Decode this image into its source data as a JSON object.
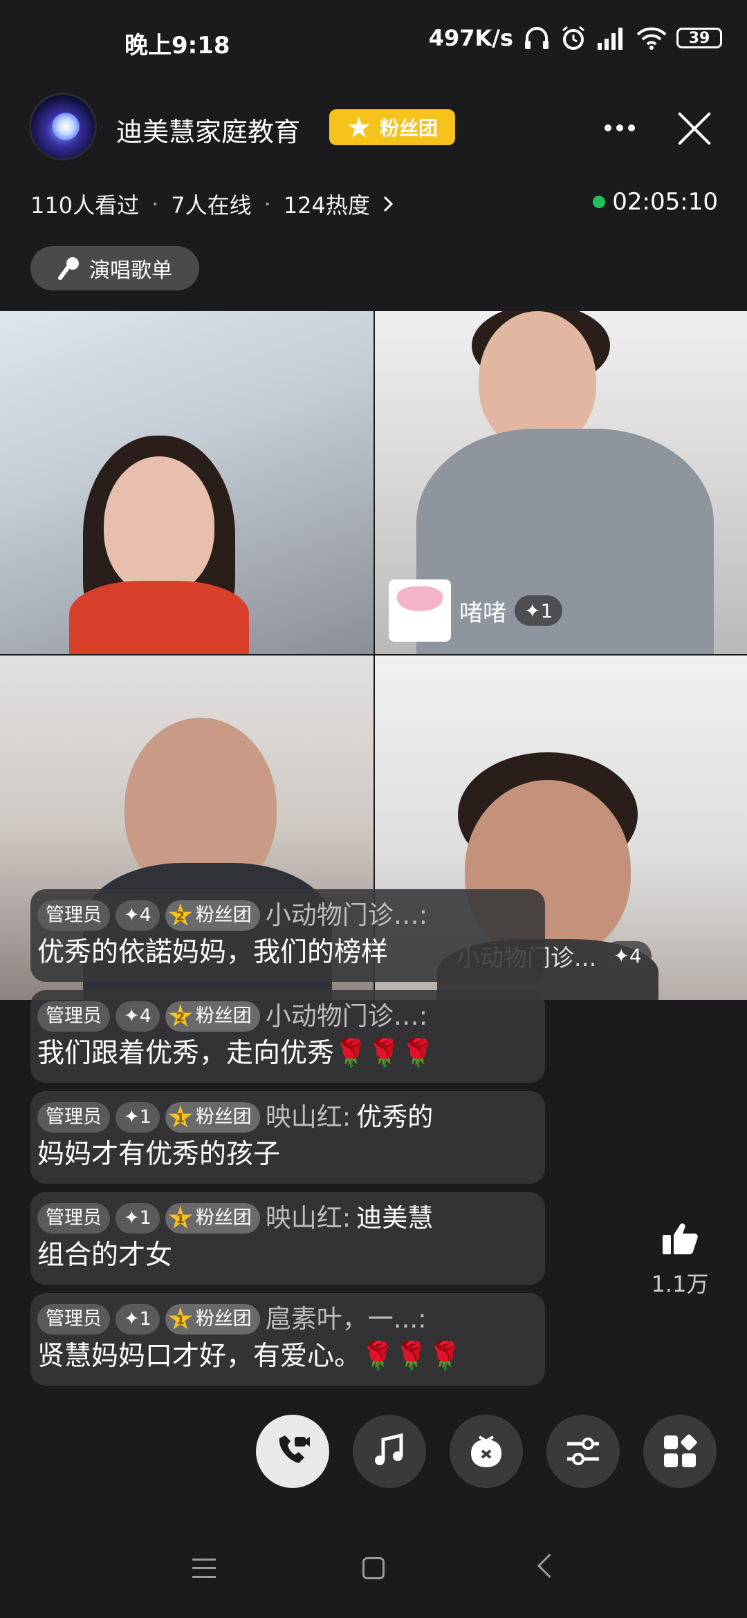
{
  "status": {
    "time": "晚上9:18",
    "speed": "497K/s",
    "battery": "39"
  },
  "header": {
    "channel_name": "迪美慧家庭教育",
    "fan_badge": "粉丝团"
  },
  "stats": {
    "viewed": "110人看过",
    "online": "7人在线",
    "heat": "124热度",
    "live_time": "02:05:10"
  },
  "playlist": {
    "label": "演唱歌单"
  },
  "video": {
    "tile2_name": "啫啫",
    "tile2_badge": "✦1",
    "tile4_name": "小动物门诊...",
    "tile4_badge": "✦4"
  },
  "chat": [
    {
      "role": "管理员",
      "level": "✦4",
      "fan_level": "2",
      "fan": "粉丝团",
      "user": "小动物门诊…:",
      "text1": "",
      "text2": "优秀的依諾妈妈，我们的榜样"
    },
    {
      "role": "管理员",
      "level": "✦4",
      "fan_level": "2",
      "fan": "粉丝团",
      "user": "小动物门诊…:",
      "text1": "",
      "text2": "我们跟着优秀，走向优秀🌹🌹🌹"
    },
    {
      "role": "管理员",
      "level": "✦1",
      "fan_level": "1",
      "fan": "粉丝团",
      "user": "映山红:",
      "text1": "优秀的",
      "text2": "妈妈才有优秀的孩子"
    },
    {
      "role": "管理员",
      "level": "✦1",
      "fan_level": "1",
      "fan": "粉丝团",
      "user": "映山红:",
      "text1": "迪美慧",
      "text2": "组合的才女"
    },
    {
      "role": "管理员",
      "level": "✦1",
      "fan_level": "1",
      "fan": "粉丝团",
      "user": "扈素叶，一...:",
      "text1": "",
      "text2": "贤慧妈妈口才好，有爱心。🌹🌹🌹"
    }
  ],
  "likes": {
    "count": "1.1万"
  },
  "icons": [
    "avatar",
    "more-icon",
    "close-icon",
    "mic-icon",
    "thumb-up-icon",
    "video-call-icon",
    "music-icon",
    "gift-bag-icon",
    "settings-sliders-icon",
    "apps-icon",
    "nav-menu-icon",
    "nav-home-icon",
    "nav-back-icon"
  ],
  "colors": {
    "accent_gold": "#f6c31c",
    "live_green": "#21c25e",
    "background": "#1b1b1d"
  }
}
